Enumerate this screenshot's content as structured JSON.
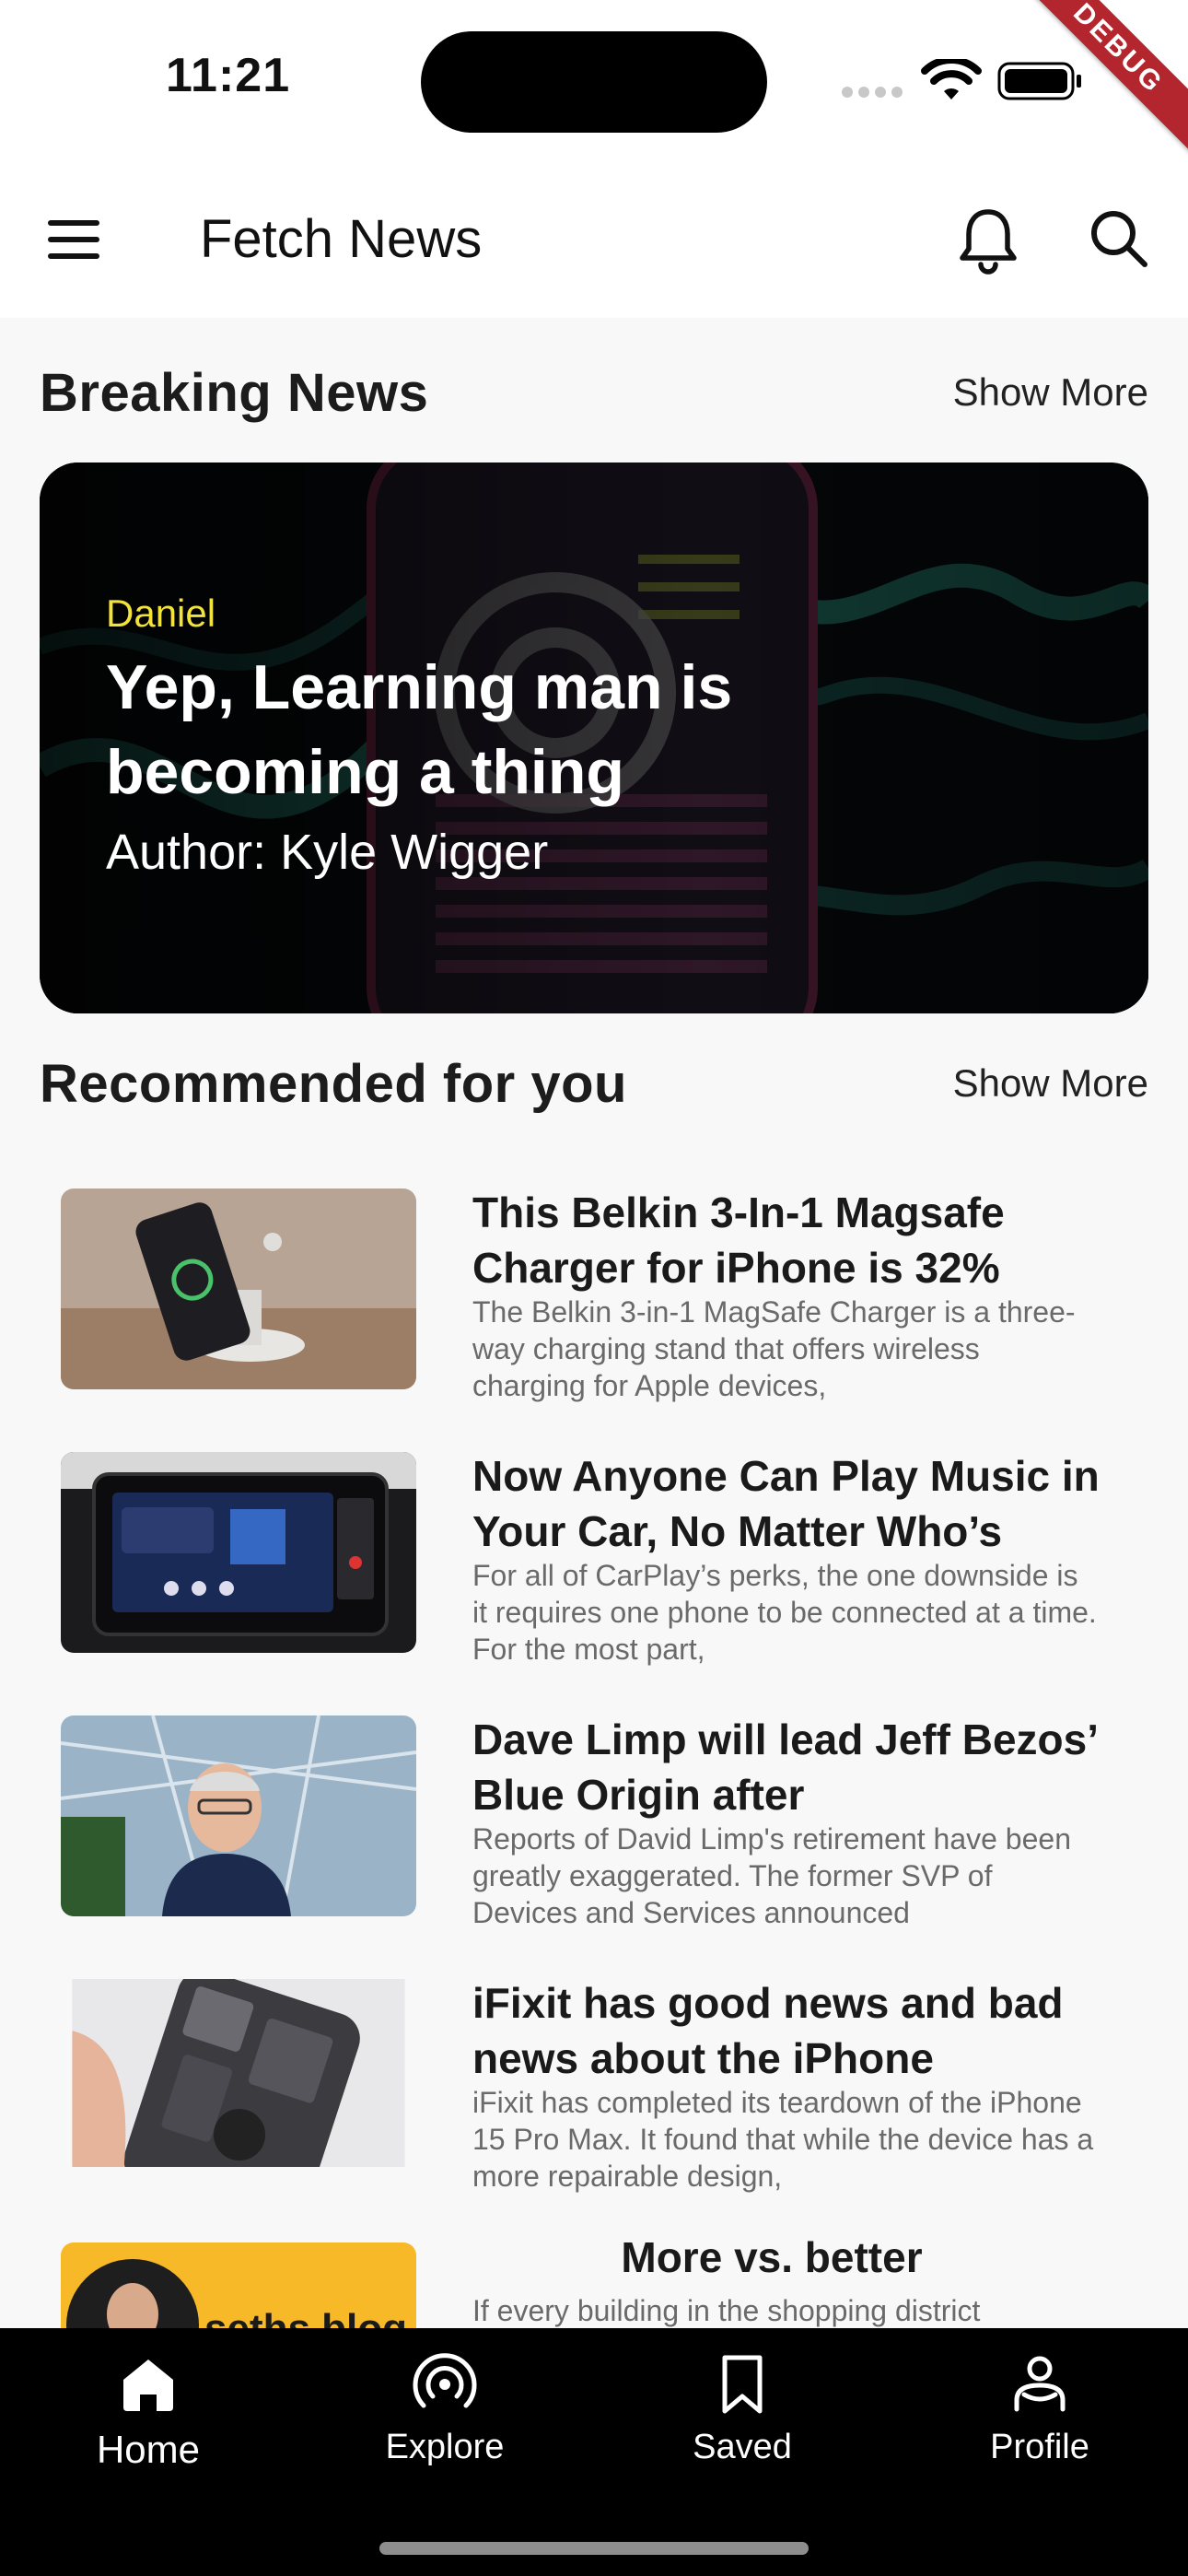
{
  "status_bar": {
    "time": "11:21",
    "debug_label": "DEBUG"
  },
  "app_bar": {
    "title": "Fetch News"
  },
  "breaking": {
    "section_title": "Breaking News",
    "show_more": "Show More",
    "card": {
      "source": "Daniel",
      "headline": "Yep, Learning man is becoming a thing",
      "author": "Author: Kyle Wigger"
    }
  },
  "recommended": {
    "section_title": "Recommended for you",
    "show_more": "Show More",
    "items": [
      {
        "title": "This Belkin 3-In-1 Magsafe Charger for iPhone is 32%",
        "description": "The Belkin 3-in-1 MagSafe Charger is a three-way charging stand that offers wireless charging for Apple devices,"
      },
      {
        "title": "Now Anyone Can Play Music in Your Car, No Matter Who’s",
        "description": "For all of CarPlay’s perks, the one downside is it requires one phone to be connected at a time. For the most part,"
      },
      {
        "title": "Dave Limp will lead Jeff Bezos’ Blue Origin after",
        "description": "Reports of David Limp's retirement have been greatly exaggerated. The former SVP of Devices and Services announced"
      },
      {
        "title": "iFixit has good news and bad news about the iPhone",
        "description": "iFixit has completed its teardown of the iPhone 15 Pro Max. It found that while the device has a more repairable design,"
      },
      {
        "title": "More vs. better",
        "description": "If every building in the shopping district",
        "thumb_text": "seths blog"
      }
    ]
  },
  "bottom_nav": {
    "items": [
      {
        "label": "Home",
        "icon": "home-icon",
        "active": true
      },
      {
        "label": "Explore",
        "icon": "broadcast-icon",
        "active": false
      },
      {
        "label": "Saved",
        "icon": "bookmark-icon",
        "active": false
      },
      {
        "label": "Profile",
        "icon": "person-icon",
        "active": false
      }
    ]
  },
  "colors": {
    "accent_source": "#f2e23a",
    "nav_background": "#000000",
    "page_background": "#f8f8f8",
    "debug_banner": "#b3262e"
  }
}
